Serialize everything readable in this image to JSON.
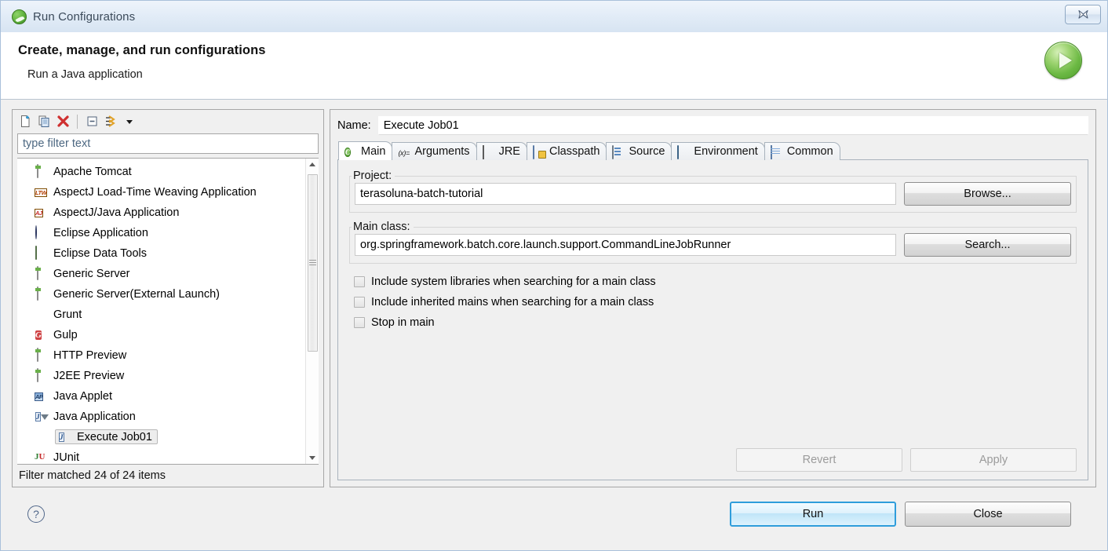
{
  "window": {
    "title": "Run Configurations",
    "title_icon": "spring-leaf-icon",
    "close_icon": "close-icon"
  },
  "header": {
    "title": "Create, manage, and run configurations",
    "subtitle": "Run a Java application",
    "run_icon": "green-run-play-icon"
  },
  "tree_panel": {
    "toolbar": [
      {
        "name": "new-configuration-button",
        "icon": "new-page-icon"
      },
      {
        "name": "duplicate-configuration-button",
        "icon": "copy-page-icon"
      },
      {
        "name": "delete-configuration-button",
        "icon": "red-x-delete-icon"
      },
      {
        "name": "collapse-all-button",
        "icon": "collapse-all-icon"
      },
      {
        "name": "filter-launch-button",
        "icon": "filter-arrow-icon"
      },
      {
        "name": "view-menu-button",
        "icon": "chevron-down-icon"
      }
    ],
    "filter_placeholder": "type filter text",
    "filter_value": "",
    "items": [
      {
        "label": "Apache Tomcat",
        "icon": "server-icon",
        "indent": 0,
        "selected": false,
        "expandable": false
      },
      {
        "label": "AspectJ Load-Time Weaving Application",
        "icon": "ltw-icon",
        "indent": 0,
        "selected": false,
        "expandable": false
      },
      {
        "label": "AspectJ/Java Application",
        "icon": "aspectj-java-icon",
        "indent": 0,
        "selected": false,
        "expandable": false
      },
      {
        "label": "Eclipse Application",
        "icon": "eclipse-icon",
        "indent": 0,
        "selected": false,
        "expandable": false
      },
      {
        "label": "Eclipse Data Tools",
        "icon": "database-icon",
        "indent": 0,
        "selected": false,
        "expandable": false
      },
      {
        "label": "Generic Server",
        "icon": "server-icon",
        "indent": 0,
        "selected": false,
        "expandable": false
      },
      {
        "label": "Generic Server(External Launch)",
        "icon": "server-icon",
        "indent": 0,
        "selected": false,
        "expandable": false
      },
      {
        "label": "Grunt",
        "icon": "grunt-icon",
        "indent": 0,
        "selected": false,
        "expandable": false
      },
      {
        "label": "Gulp",
        "icon": "gulp-icon",
        "indent": 0,
        "selected": false,
        "expandable": false
      },
      {
        "label": "HTTP Preview",
        "icon": "server-icon",
        "indent": 0,
        "selected": false,
        "expandable": false
      },
      {
        "label": "J2EE Preview",
        "icon": "server-icon",
        "indent": 0,
        "selected": false,
        "expandable": false
      },
      {
        "label": "Java Applet",
        "icon": "java-applet-icon",
        "indent": 0,
        "selected": false,
        "expandable": false
      },
      {
        "label": "Java Application",
        "icon": "java-application-icon",
        "indent": 0,
        "selected": false,
        "expandable": true
      },
      {
        "label": "Execute Job01",
        "icon": "java-application-icon",
        "indent": 1,
        "selected": true,
        "expandable": false
      },
      {
        "label": "JUnit",
        "icon": "junit-icon",
        "indent": 0,
        "selected": false,
        "expandable": false
      }
    ],
    "status": "Filter matched 24 of 24 items",
    "scrollbar": {
      "up_icon": "scroll-up-arrow-icon",
      "down_icon": "scroll-down-arrow-icon"
    }
  },
  "config": {
    "name_label": "Name:",
    "name_value": "Execute Job01",
    "tabs": [
      {
        "label": "Main",
        "icon": "main-tab-icon",
        "active": true
      },
      {
        "label": "Arguments",
        "icon": "arguments-tab-icon",
        "active": false
      },
      {
        "label": "JRE",
        "icon": "jre-tab-icon",
        "active": false
      },
      {
        "label": "Classpath",
        "icon": "classpath-tab-icon",
        "active": false
      },
      {
        "label": "Source",
        "icon": "source-tab-icon",
        "active": false
      },
      {
        "label": "Environment",
        "icon": "environment-tab-icon",
        "active": false
      },
      {
        "label": "Common",
        "icon": "common-tab-icon",
        "active": false
      }
    ],
    "project": {
      "legend": "Project:",
      "value": "terasoluna-batch-tutorial",
      "button": "Browse..."
    },
    "main_class": {
      "legend": "Main class:",
      "value": "org.springframework.batch.core.launch.support.CommandLineJobRunner",
      "button": "Search..."
    },
    "checkboxes": [
      {
        "label": "Include system libraries when searching for a main class",
        "checked": false
      },
      {
        "label": "Include inherited mains when searching for a main class",
        "checked": false
      },
      {
        "label": "Stop in main",
        "checked": false
      }
    ],
    "revert_button": "Revert",
    "apply_button": "Apply",
    "revert_enabled": false,
    "apply_enabled": false
  },
  "footer": {
    "help_icon": "help-question-icon",
    "run_button": "Run",
    "close_button": "Close"
  },
  "colors": {
    "accent_blue": "#2f9ddb",
    "run_green": "#4e9c2c",
    "delete_red": "#cf3030",
    "dialog_bg": "#f0f0f0"
  }
}
